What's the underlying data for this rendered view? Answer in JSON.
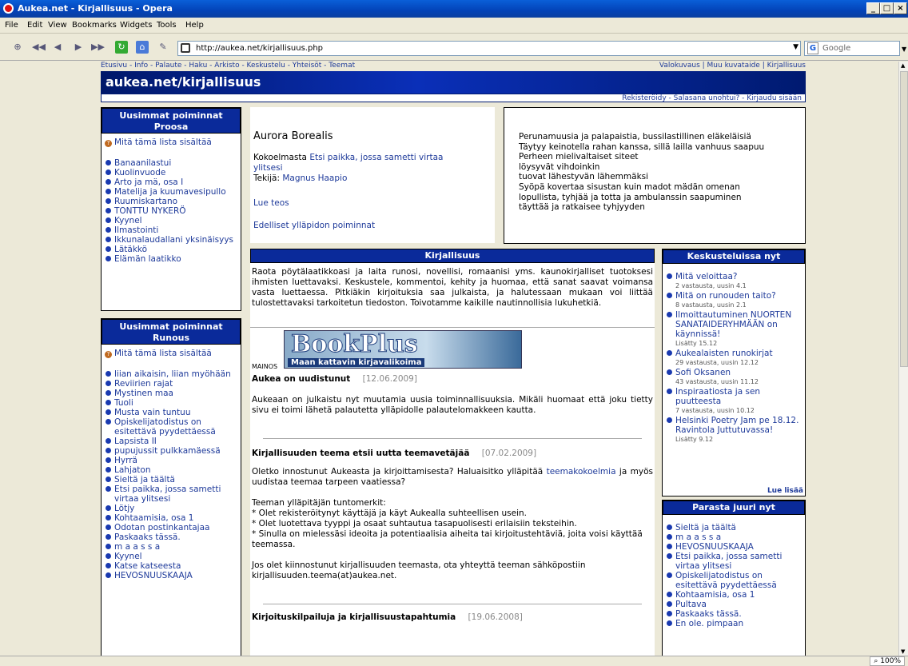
{
  "window": {
    "title": "Aukea.net - Kirjallisuus - Opera"
  },
  "menu": [
    "File",
    "Edit",
    "View",
    "Bookmarks",
    "Widgets",
    "Tools",
    "Help"
  ],
  "address": {
    "url": "http://aukea.net/kirjallisuus.php"
  },
  "search": {
    "engine": "Google"
  },
  "status": {
    "zoom": "100%"
  },
  "topnav": {
    "left": "Etusivu - Info - Palaute - Haku - Arkisto - Keskustelu - Yhteisöt - Teemat",
    "right": "Valokuvaus | Muu kuvataide | Kirjallisuus"
  },
  "banner": {
    "title": "aukea.net/kirjallisuus",
    "account": "Rekisteröidy - Salasana unohtui? - Kirjaudu sisään"
  },
  "proosa": {
    "header": "Uusimmat poiminnat Proosa",
    "help": "Mitä tämä lista sisältää",
    "items": [
      "Banaanilastui",
      "Kuolinvuode",
      "Arto ja mä, osa I",
      "Matelija ja kuumavesipullo",
      "Ruumiskartano",
      "TONTTU NYKERÖ",
      "Kyynel",
      "Ilmastointi",
      "Ikkunalaudallani yksinäisyys",
      "Lätäkkö",
      "Elämän laatikko"
    ]
  },
  "runous": {
    "header": "Uusimmat poiminnat Runous",
    "help": "Mitä tämä lista sisältää",
    "items": [
      "liian aikaisin, liian myöhään",
      "Reviirien rajat",
      "Mystinen maa",
      "Tuoli",
      "Musta vain tuntuu",
      "Opiskelijatodistus on esitettävä pyydettäessä",
      "Lapsista II",
      "pupujussit pulkkamäessä",
      "Hyrrä",
      "Lahjaton",
      "Sieltä ja täältä",
      "Etsi paikka, jossa sametti virtaa ylitsesi",
      "Lötjy",
      "Kohtaamisia, osa 1",
      "Odotan postinkantajaa",
      "Paskaaks tässä.",
      "m a a s s a",
      "Kyynel",
      "Katse katseesta",
      "HEVOSNUUSKAAJA"
    ]
  },
  "featured": {
    "title": "Aurora Borealis",
    "collection_prefix": "Kokoelmasta",
    "collection": "Etsi paikka, jossa sametti virtaa ylitsesi",
    "author_prefix": "Tekijä:",
    "author": "Magnus Haapio",
    "read": "Lue teos",
    "previous": "Edelliset ylläpidon poiminnat"
  },
  "poem": [
    "Perunamuusia ja palapaistia, bussilastillinen eläkeläisiä",
    "Täytyy keinotella rahan kanssa, sillä lailla vanhuus saapuu",
    "Perheen mielivaltaiset siteet",
    "löysyvät vihdoinkin",
    "tuovat lähestyvän lähemmäksi",
    "Syöpä kovertaa sisustan kuin madot mädän omenan",
    "lopullista, tyhjää ja totta ja ambulanssin saapuminen",
    "täyttää ja ratkaisee tyhjyyden"
  ],
  "main": {
    "header": "Kirjallisuus",
    "intro": "Raota pöytälaatikkoasi ja laita runosi, novellisi, romaanisi yms. kaunokirjalliset tuotoksesi ihmisten luettavaksi. Keskustele, kommentoi, kehity ja huomaa, että sanat saavat voimansa vasta luettaessa. Pitkiäkin kirjoituksia saa julkaista, ja halutessaan mukaan voi liittää tulostettavaksi tarkoitetun tiedoston. Toivotamme kaikille nautinnollisia lukuhetkiä.",
    "ad_label": "MAINOS",
    "ad_title": "BookPlus",
    "ad_sub": "Maan kattavin kirjavalikoima",
    "news1_title": "Aukea on uudistunut",
    "news1_date": "[12.06.2009]",
    "news1_body": "Aukeaan on julkaistu nyt muutamia uusia toiminnallisuuksia. Mikäli huomaat että joku tietty sivu ei toimi lähetä palautetta ylläpidolle palautelomakkeen kautta.",
    "news2_title": "Kirjallisuuden teema etsii uutta teemavetäjää",
    "news2_date": "[07.02.2009]",
    "news2_p1_a": "Oletko innostunut Aukeasta ja kirjoittamisesta? Haluaisitko ylläpitää",
    "news2_p1_link": "teemakokoelmia",
    "news2_p1_b": "ja myös uudistaa teemaa tarpeen vaatiessa?",
    "news2_p2": "Teeman ylläpitäjän tuntomerkit:",
    "news2_b1": "* Olet rekisteröitynyt käyttäjä ja käyt Aukealla suhteellisen usein.",
    "news2_b2": "* Olet luotettava tyyppi ja osaat suhtautua tasapuolisesti erilaisiin teksteihin.",
    "news2_b3": "* Sinulla on mielessäsi ideoita ja potentiaalisia aiheita tai kirjoitustehtäviä, joita voisi käyttää teemassa.",
    "news2_p3": "Jos olet kiinnostunut kirjallisuuden teemasta, ota yhteyttä teeman sähköpostiin kirjallisuuden.teema(at)aukea.net.",
    "news3_title": "Kirjoituskilpailuja ja kirjallisuustapahtumia",
    "news3_date": "[19.06.2008]"
  },
  "discussion": {
    "header": "Keskusteluissa nyt",
    "items": [
      {
        "t": "Mitä veloittaa?",
        "s": "2 vastausta, uusin 4.1"
      },
      {
        "t": "Mitä on runouden taito?",
        "s": "8 vastausta, uusin 2.1"
      },
      {
        "t": "Ilmoittautuminen NUORTEN SANATAIDERYHMÄÄN on käynnissä!",
        "s": "Lisätty 15.12"
      },
      {
        "t": "Aukealaisten runokirjat",
        "s": "29 vastausta, uusin 12.12"
      },
      {
        "t": "Sofi Oksanen",
        "s": "43 vastausta, uusin 11.12"
      },
      {
        "t": "Inspiraatiosta ja sen puutteesta",
        "s": "7 vastausta, uusin 10.12"
      },
      {
        "t": "Helsinki Poetry Jam pe 18.12. Ravintola Juttutuvassa!",
        "s": "Lisätty 9.12"
      }
    ],
    "more": "Lue lisää"
  },
  "best": {
    "header": "Parasta juuri nyt",
    "items": [
      "Sieltä ja täältä",
      "m a a s s a",
      "HEVOSNUUSKAAJA",
      "Etsi paikka, jossa sametti virtaa ylitsesi",
      "Opiskelijatodistus on esitettävä pyydettäessä",
      "Kohtaamisia, osa 1",
      "Pultava",
      "Paskaaks tässä.",
      "En ole. pimpaan"
    ]
  }
}
